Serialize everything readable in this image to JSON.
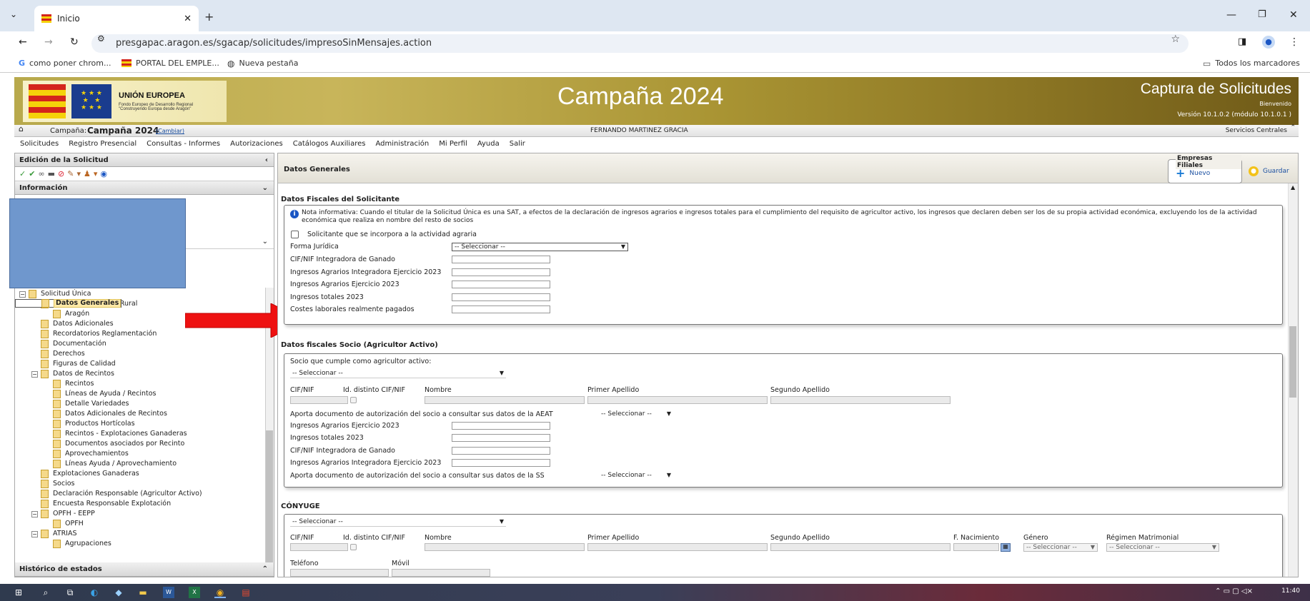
{
  "browser": {
    "tab_title": "Inicio",
    "url": "presgapac.aragon.es/sgacap/solicitudes/impresoSinMensajes.action",
    "bookmarks": [
      "como poner chrom...",
      "PORTAL DEL EMPLE...",
      "Nueva pestaña"
    ],
    "all_bookmarks": "Todos los marcadores"
  },
  "banner": {
    "eu_title": "UNIÓN EUROPEA",
    "eu_fund": "Fondo Europeo de Desarrollo Regional",
    "eu_motto": "\"Construyendo Europa desde Aragón\"",
    "campaign": "Campaña 2024",
    "app_title": "Captura de Solicitudes",
    "welcome": "Bienvenido",
    "version": "Versión 10.1.0.2 (módulo 10.1.0.1 )"
  },
  "status": {
    "campaign_label": "Campaña:",
    "campaign_value": "Campaña 2024",
    "change_link": "(Cambiar)",
    "user": "FERNANDO MARTINEZ GRACIA",
    "org": "Servicios Centrales"
  },
  "menu": [
    "Solicitudes",
    "Registro Presencial",
    "Consultas - Informes",
    "Autorizaciones",
    "Catálogos Auxiliares",
    "Administración",
    "Mi Perfil",
    "Ayuda",
    "Salir"
  ],
  "left": {
    "edit_title": "Edición de la Solicitud",
    "info_title": "Información",
    "history_title": "Histórico de estados",
    "tree": [
      {
        "label": "Solicitud Única",
        "level": 0,
        "exp": true,
        "folder": true
      },
      {
        "label": "Datos Generales",
        "level": 1,
        "selected": true
      },
      {
        "label": "Solicitas Desarrollo Rural",
        "level": 1,
        "exp": true,
        "folder": true
      },
      {
        "label": "Aragón",
        "level": 2
      },
      {
        "label": "Datos Adicionales",
        "level": 1
      },
      {
        "label": "Recordatorios Reglamentación",
        "level": 1
      },
      {
        "label": "Documentación",
        "level": 1
      },
      {
        "label": "Derechos",
        "level": 1
      },
      {
        "label": "Figuras de Calidad",
        "level": 1
      },
      {
        "label": "Datos de Recintos",
        "level": 1,
        "exp": true,
        "folder": true
      },
      {
        "label": "Recintos",
        "level": 2
      },
      {
        "label": "Líneas de Ayuda / Recintos",
        "level": 2
      },
      {
        "label": "Detalle Variedades",
        "level": 2
      },
      {
        "label": "Datos Adicionales de Recintos",
        "level": 2
      },
      {
        "label": "Productos Hortícolas",
        "level": 2
      },
      {
        "label": "Recintos - Explotaciones Ganaderas",
        "level": 2
      },
      {
        "label": "Documentos asociados por Recinto",
        "level": 2
      },
      {
        "label": "Aprovechamientos",
        "level": 2
      },
      {
        "label": "Líneas Ayuda / Aprovechamiento",
        "level": 2
      },
      {
        "label": "Explotaciones Ganaderas",
        "level": 1
      },
      {
        "label": "Socios",
        "level": 1
      },
      {
        "label": "Declaración Responsable (Agricultor Activo)",
        "level": 1
      },
      {
        "label": "Encuesta Responsable Explotación",
        "level": 1
      },
      {
        "label": "OPFH - EEPP",
        "level": 1,
        "exp": true,
        "folder": true
      },
      {
        "label": "OPFH",
        "level": 2
      },
      {
        "label": "ATRIAS",
        "level": 1,
        "exp": true,
        "folder": true
      },
      {
        "label": "Agrupaciones",
        "level": 2
      }
    ]
  },
  "right": {
    "title": "Datos Generales",
    "filiales_legend": "Empresas Filiales",
    "nuevo": "Nuevo",
    "guardar": "Guardar",
    "sec1": {
      "title": "Datos Fiscales del Solicitante",
      "note": "Nota informativa: Cuando el titular de la Solicitud Única es una SAT, a efectos de la declaración de ingresos agrarios e ingresos totales para el cumplimiento del requisito de agricultor activo, los ingresos que declaren deben ser los de su propia actividad económica, excluyendo los de la actividad económica que realiza en nombre del resto de socios",
      "checkbox": "Solicitante que se incorpora a la actividad agraria",
      "forma_juridica": "Forma Jurídica",
      "forma_value": "-- Seleccionar --",
      "cif_integradora": "CIF/NIF Integradora de Ganado",
      "ing_integradora": "Ingresos Agrarios Integradora Ejercicio 2023",
      "ing_agrarios": "Ingresos Agrarios Ejercicio 2023",
      "ing_totales": "Ingresos totales 2023",
      "costes": "Costes laborales realmente pagados"
    },
    "sec2": {
      "title": "Datos fiscales Socio (Agricultor Activo)",
      "socio_label": "Socio que cumple como agricultor activo:",
      "socio_value": "-- Seleccionar --",
      "col_cif": "CIF/NIF",
      "col_id": "Id. distinto CIF/NIF",
      "col_nombre": "Nombre",
      "col_ape1": "Primer Apellido",
      "col_ape2": "Segundo Apellido",
      "aeat": "Aporta documento de autorización del socio a consultar sus datos de la AEAT",
      "aeat_value": "-- Seleccionar --",
      "ing_agrarios": "Ingresos Agrarios Ejercicio 2023",
      "ing_totales": "Ingresos totales 2023",
      "cif_integradora": "CIF/NIF Integradora de Ganado",
      "ing_integradora": "Ingresos Agrarios Integradora Ejercicio 2023",
      "ss": "Aporta documento de autorización del socio a consultar sus datos de la SS",
      "ss_value": "-- Seleccionar --"
    },
    "sec3": {
      "title": "CÓNYUGE",
      "sel_value": "-- Seleccionar --",
      "col_cif": "CIF/NIF",
      "col_id": "Id. distinto CIF/NIF",
      "col_nombre": "Nombre",
      "col_ape1": "Primer Apellido",
      "col_ape2": "Segundo Apellido",
      "col_nac": "F. Nacimiento",
      "col_genero": "Género",
      "genero_value": "-- Seleccionar --",
      "col_regimen": "Régimen Matrimonial",
      "regimen_value": "-- Seleccionar --",
      "telefono": "Teléfono",
      "movil": "Móvil"
    }
  },
  "taskbar": {
    "time": "11:40"
  }
}
